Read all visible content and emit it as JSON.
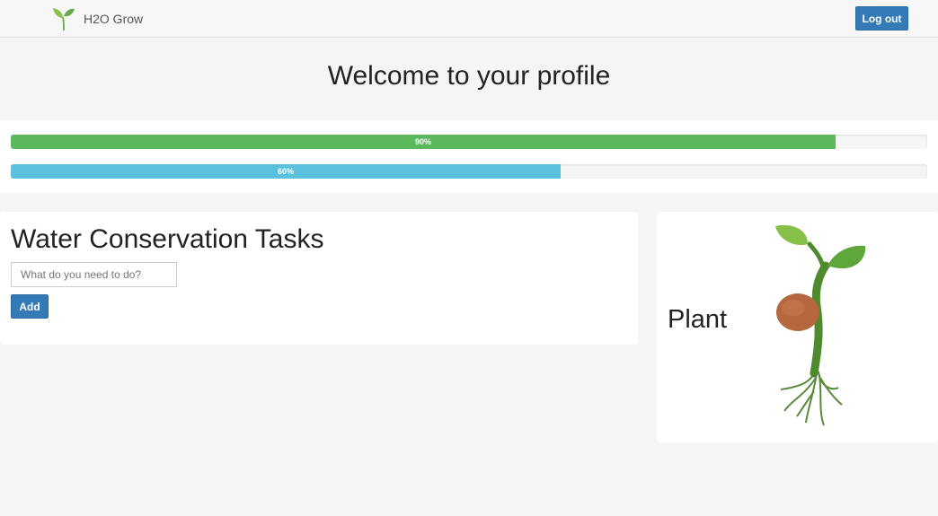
{
  "navbar": {
    "brand": "H2O Grow",
    "brand_icon": "sprout-icon",
    "logout_label": "Log out"
  },
  "page": {
    "title": "Welcome to your profile"
  },
  "progress": [
    {
      "label": "90%",
      "value": 90,
      "color": "#5cb85c"
    },
    {
      "label": "60%",
      "value": 60,
      "color": "#5bc0de"
    }
  ],
  "tasks": {
    "title": "Water Conservation Tasks",
    "input_placeholder": "What do you need to do?",
    "input_value": "",
    "add_label": "Add"
  },
  "plant": {
    "label": "Plant",
    "image": "sprouting-seed-illustration"
  },
  "colors": {
    "primary": "#337ab7",
    "success": "#5cb85c",
    "info": "#5bc0de",
    "background": "#f5f5f5"
  }
}
